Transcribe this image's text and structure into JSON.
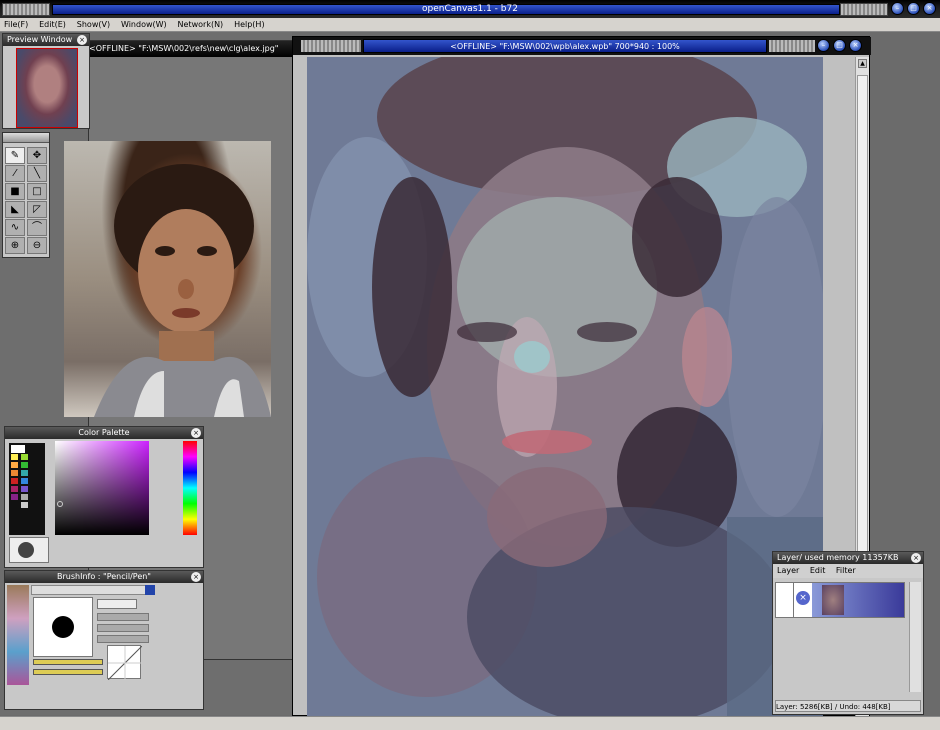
{
  "app": {
    "title": "openCanvas1.1 - b72"
  },
  "menu": [
    "File(F)",
    "Edit(E)",
    "Show(V)",
    "Window(W)",
    "Network(N)",
    "Help(H)"
  ],
  "preview": {
    "title": "Preview Window"
  },
  "reference": {
    "title": "<OFFLINE> \"F:\\MSW\\002\\refs\\new\\clg\\alex.jpg\""
  },
  "document": {
    "title": "<OFFLINE> \"F:\\MSW\\002\\wpb\\alex.wpb\" 700*940 : 100%"
  },
  "tools": [
    "pen-tool",
    "move-tool",
    "eyedropper-tool",
    "line-tool",
    "fill-black-tool",
    "select-rect-tool",
    "lasso-fill-tool",
    "lasso-tool",
    "curve-tool",
    "polyline-tool",
    "zoom-in-tool",
    "zoom-out-tool"
  ],
  "palette": {
    "title": "Color Palette"
  },
  "brush": {
    "title": "BrushInfo : \"Pencil/Pen\""
  },
  "layer": {
    "title": "Layer/ used memory 11357KB",
    "menu": [
      "Layer",
      "Edit",
      "Filter"
    ],
    "status": "Layer: 5286[KB] / Undo: 448[KB]"
  },
  "colors": {
    "title_blue": "#1a33aa",
    "panel_gray": "#c8c8c8",
    "workspace": "#6b6b6b"
  }
}
